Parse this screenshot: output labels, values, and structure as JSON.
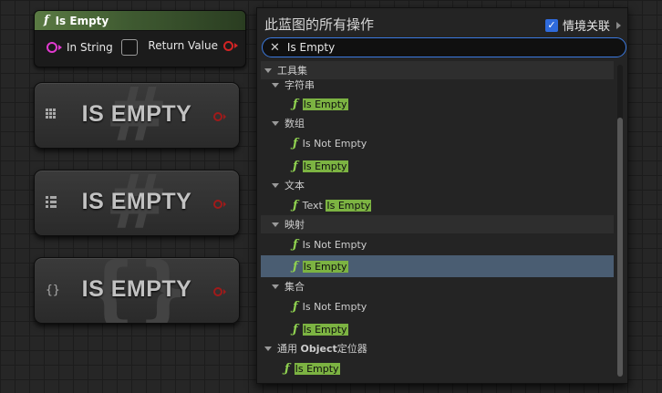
{
  "function_node": {
    "glyph": "f",
    "title": "Is Empty",
    "input_pin_label": "In String",
    "output_pin_label": "Return Value"
  },
  "compact_nodes": [
    {
      "title": "IS EMPTY",
      "type_icon": "grid-icon",
      "watermark": "#"
    },
    {
      "title": "IS EMPTY",
      "type_icon": "list-icon",
      "watermark": "#"
    },
    {
      "title": "IS EMPTY",
      "type_icon": "braces-icon",
      "type_glyph": "{}",
      "watermark": "{}"
    }
  ],
  "menu": {
    "title": "此蓝图的所有操作",
    "context_label": "情境关联",
    "context_checked": true,
    "search": {
      "value": "Is Empty",
      "clear_glyph": "✕"
    },
    "fx_glyph": "ƒ",
    "tree": {
      "toolset": "工具集",
      "string_cat": "字符串",
      "string_item": "Is Empty",
      "array_cat": "数组",
      "array_item1": "Is Not Empty",
      "array_item2": "Is Empty",
      "text_cat": "文本",
      "text_item_prefix": "Text ",
      "text_item_match": "Is Empty",
      "map_cat": "映射",
      "map_item1": "Is Not Empty",
      "map_item2": "Is Empty",
      "set_cat": "集合",
      "set_item1": "Is Not Empty",
      "set_item2": "Is Empty",
      "object_cat_prefix": "通用 ",
      "object_cat_bold": "Object",
      "object_cat_suffix": "定位器",
      "object_item": "Is Empty"
    }
  },
  "colors": {
    "highlight": "#7cb342",
    "selection": "#4a5d72",
    "accent": "#3b7ae0",
    "string_pin": "#e23ad0",
    "bool_pin": "#d22424"
  }
}
